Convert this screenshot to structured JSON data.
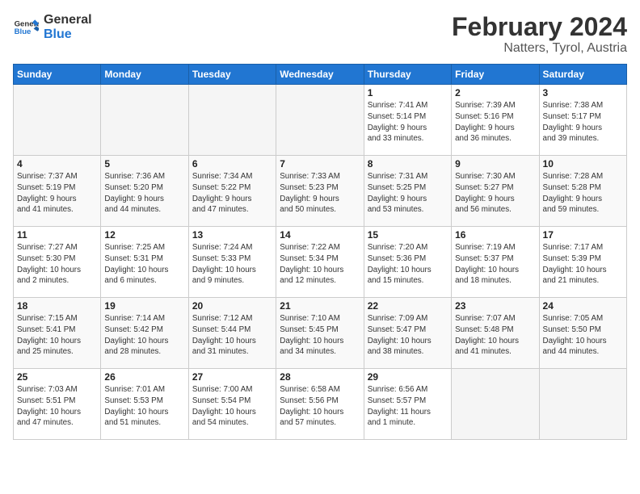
{
  "header": {
    "logo_general": "General",
    "logo_blue": "Blue",
    "title": "February 2024",
    "subtitle": "Natters, Tyrol, Austria"
  },
  "calendar": {
    "days_of_week": [
      "Sunday",
      "Monday",
      "Tuesday",
      "Wednesday",
      "Thursday",
      "Friday",
      "Saturday"
    ],
    "weeks": [
      [
        {
          "day": "",
          "info": ""
        },
        {
          "day": "",
          "info": ""
        },
        {
          "day": "",
          "info": ""
        },
        {
          "day": "",
          "info": ""
        },
        {
          "day": "1",
          "info": "Sunrise: 7:41 AM\nSunset: 5:14 PM\nDaylight: 9 hours\nand 33 minutes."
        },
        {
          "day": "2",
          "info": "Sunrise: 7:39 AM\nSunset: 5:16 PM\nDaylight: 9 hours\nand 36 minutes."
        },
        {
          "day": "3",
          "info": "Sunrise: 7:38 AM\nSunset: 5:17 PM\nDaylight: 9 hours\nand 39 minutes."
        }
      ],
      [
        {
          "day": "4",
          "info": "Sunrise: 7:37 AM\nSunset: 5:19 PM\nDaylight: 9 hours\nand 41 minutes."
        },
        {
          "day": "5",
          "info": "Sunrise: 7:36 AM\nSunset: 5:20 PM\nDaylight: 9 hours\nand 44 minutes."
        },
        {
          "day": "6",
          "info": "Sunrise: 7:34 AM\nSunset: 5:22 PM\nDaylight: 9 hours\nand 47 minutes."
        },
        {
          "day": "7",
          "info": "Sunrise: 7:33 AM\nSunset: 5:23 PM\nDaylight: 9 hours\nand 50 minutes."
        },
        {
          "day": "8",
          "info": "Sunrise: 7:31 AM\nSunset: 5:25 PM\nDaylight: 9 hours\nand 53 minutes."
        },
        {
          "day": "9",
          "info": "Sunrise: 7:30 AM\nSunset: 5:27 PM\nDaylight: 9 hours\nand 56 minutes."
        },
        {
          "day": "10",
          "info": "Sunrise: 7:28 AM\nSunset: 5:28 PM\nDaylight: 9 hours\nand 59 minutes."
        }
      ],
      [
        {
          "day": "11",
          "info": "Sunrise: 7:27 AM\nSunset: 5:30 PM\nDaylight: 10 hours\nand 2 minutes."
        },
        {
          "day": "12",
          "info": "Sunrise: 7:25 AM\nSunset: 5:31 PM\nDaylight: 10 hours\nand 6 minutes."
        },
        {
          "day": "13",
          "info": "Sunrise: 7:24 AM\nSunset: 5:33 PM\nDaylight: 10 hours\nand 9 minutes."
        },
        {
          "day": "14",
          "info": "Sunrise: 7:22 AM\nSunset: 5:34 PM\nDaylight: 10 hours\nand 12 minutes."
        },
        {
          "day": "15",
          "info": "Sunrise: 7:20 AM\nSunset: 5:36 PM\nDaylight: 10 hours\nand 15 minutes."
        },
        {
          "day": "16",
          "info": "Sunrise: 7:19 AM\nSunset: 5:37 PM\nDaylight: 10 hours\nand 18 minutes."
        },
        {
          "day": "17",
          "info": "Sunrise: 7:17 AM\nSunset: 5:39 PM\nDaylight: 10 hours\nand 21 minutes."
        }
      ],
      [
        {
          "day": "18",
          "info": "Sunrise: 7:15 AM\nSunset: 5:41 PM\nDaylight: 10 hours\nand 25 minutes."
        },
        {
          "day": "19",
          "info": "Sunrise: 7:14 AM\nSunset: 5:42 PM\nDaylight: 10 hours\nand 28 minutes."
        },
        {
          "day": "20",
          "info": "Sunrise: 7:12 AM\nSunset: 5:44 PM\nDaylight: 10 hours\nand 31 minutes."
        },
        {
          "day": "21",
          "info": "Sunrise: 7:10 AM\nSunset: 5:45 PM\nDaylight: 10 hours\nand 34 minutes."
        },
        {
          "day": "22",
          "info": "Sunrise: 7:09 AM\nSunset: 5:47 PM\nDaylight: 10 hours\nand 38 minutes."
        },
        {
          "day": "23",
          "info": "Sunrise: 7:07 AM\nSunset: 5:48 PM\nDaylight: 10 hours\nand 41 minutes."
        },
        {
          "day": "24",
          "info": "Sunrise: 7:05 AM\nSunset: 5:50 PM\nDaylight: 10 hours\nand 44 minutes."
        }
      ],
      [
        {
          "day": "25",
          "info": "Sunrise: 7:03 AM\nSunset: 5:51 PM\nDaylight: 10 hours\nand 47 minutes."
        },
        {
          "day": "26",
          "info": "Sunrise: 7:01 AM\nSunset: 5:53 PM\nDaylight: 10 hours\nand 51 minutes."
        },
        {
          "day": "27",
          "info": "Sunrise: 7:00 AM\nSunset: 5:54 PM\nDaylight: 10 hours\nand 54 minutes."
        },
        {
          "day": "28",
          "info": "Sunrise: 6:58 AM\nSunset: 5:56 PM\nDaylight: 10 hours\nand 57 minutes."
        },
        {
          "day": "29",
          "info": "Sunrise: 6:56 AM\nSunset: 5:57 PM\nDaylight: 11 hours\nand 1 minute."
        },
        {
          "day": "",
          "info": ""
        },
        {
          "day": "",
          "info": ""
        }
      ]
    ]
  }
}
